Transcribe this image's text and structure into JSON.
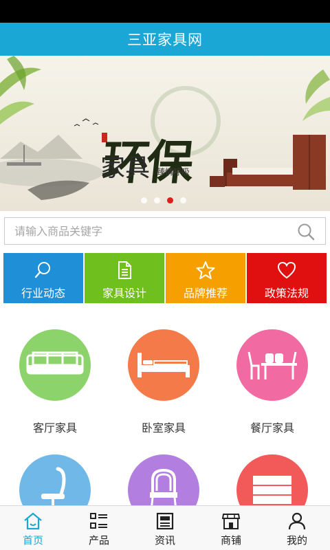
{
  "header": {
    "title": "三亚家具网"
  },
  "banner": {
    "title": "环保",
    "subtitle": "家具",
    "tagline": "臻情呼吸",
    "dots_count": 4,
    "active_dot": 3
  },
  "search": {
    "placeholder": "请输入商品关键字"
  },
  "categories": [
    {
      "label": "行业动态",
      "color": "#1f8fd8",
      "icon": "search-icon"
    },
    {
      "label": "家具设计",
      "color": "#6fbf1f",
      "icon": "document-icon"
    },
    {
      "label": "品牌推荐",
      "color": "#f5a000",
      "icon": "star-icon"
    },
    {
      "label": "政策法规",
      "color": "#e01010",
      "icon": "heart-icon"
    }
  ],
  "products": [
    {
      "label": "客厅家具",
      "color": "#8dd36b",
      "icon": "sofa-icon"
    },
    {
      "label": "卧室家具",
      "color": "#f47a4a",
      "icon": "bed-icon"
    },
    {
      "label": "餐厅家具",
      "color": "#f26aa2",
      "icon": "dining-table-icon"
    },
    {
      "label": "",
      "color": "#6fb8e8",
      "icon": "office-chair-icon"
    },
    {
      "label": "",
      "color": "#b27ee0",
      "icon": "armchair-icon"
    },
    {
      "label": "",
      "color": "#f25a5a",
      "icon": "cabinet-icon"
    }
  ],
  "tabs": [
    {
      "label": "首页",
      "icon": "home-icon",
      "active": true
    },
    {
      "label": "产品",
      "icon": "list-icon",
      "active": false
    },
    {
      "label": "资讯",
      "icon": "news-icon",
      "active": false
    },
    {
      "label": "商铺",
      "icon": "shop-icon",
      "active": false
    },
    {
      "label": "我的",
      "icon": "user-icon",
      "active": false
    }
  ]
}
